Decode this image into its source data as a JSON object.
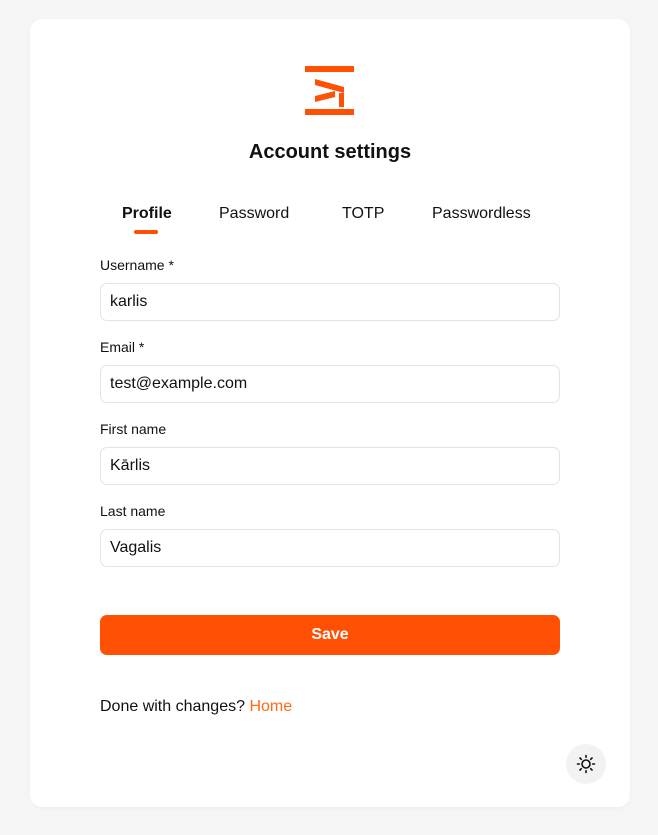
{
  "page": {
    "title": "Account settings"
  },
  "logo": {
    "icon": "brand-logo-icon",
    "color": "#ff5004"
  },
  "tabs": [
    {
      "label": "Profile",
      "active": true
    },
    {
      "label": "Password",
      "active": false
    },
    {
      "label": "TOTP",
      "active": false
    },
    {
      "label": "Passwordless",
      "active": false
    }
  ],
  "form": {
    "username": {
      "label": "Username *",
      "value": "karlis"
    },
    "email": {
      "label": "Email *",
      "value": "test@example.com"
    },
    "first_name": {
      "label": "First name",
      "value": "Kārlis"
    },
    "last_name": {
      "label": "Last name",
      "value": "Vagalis"
    },
    "save_label": "Save"
  },
  "footer": {
    "prompt": "Done with changes?",
    "link_label": "Home"
  },
  "theme_toggle": {
    "icon": "sun-icon"
  },
  "colors": {
    "accent": "#ff5004",
    "link": "#ff6a13"
  }
}
